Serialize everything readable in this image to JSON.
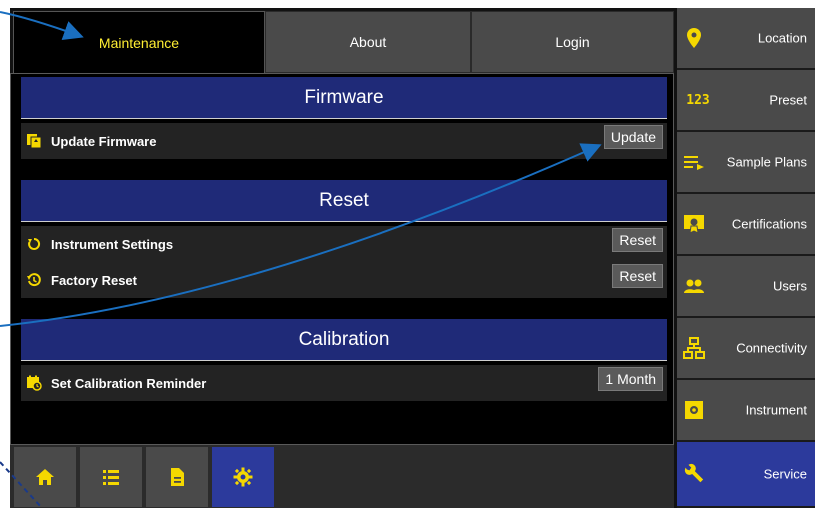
{
  "tabs": [
    {
      "label": "Maintenance",
      "active": true
    },
    {
      "label": "About",
      "active": false
    },
    {
      "label": "Login",
      "active": false
    }
  ],
  "sections": {
    "firmware": {
      "title": "Firmware",
      "rows": [
        {
          "label": "Update Firmware",
          "button": "Update",
          "icon": "firmware-update-icon"
        }
      ]
    },
    "reset": {
      "title": "Reset",
      "rows": [
        {
          "label": "Instrument Settings",
          "button": "Reset",
          "icon": "reset-icon"
        },
        {
          "label": "Factory Reset",
          "button": "Reset",
          "icon": "history-icon"
        }
      ]
    },
    "calibration": {
      "title": "Calibration",
      "rows": [
        {
          "label": "Set Calibration Reminder",
          "button": "1 Month",
          "icon": "calendar-clock-icon"
        }
      ]
    }
  },
  "bottom_nav": [
    {
      "icon": "home-icon"
    },
    {
      "icon": "list-icon"
    },
    {
      "icon": "document-icon"
    },
    {
      "icon": "gear-icon",
      "active": true
    }
  ],
  "sidebar": [
    {
      "label": "Location",
      "icon": "location-pin-icon"
    },
    {
      "label": "Preset",
      "icon": "numbers-123-icon"
    },
    {
      "label": "Sample Plans",
      "icon": "playlist-icon"
    },
    {
      "label": "Certifications",
      "icon": "certificate-icon"
    },
    {
      "label": "Users",
      "icon": "users-icon"
    },
    {
      "label": "Connectivity",
      "icon": "network-icon"
    },
    {
      "label": "Instrument",
      "icon": "instrument-icon"
    },
    {
      "label": "Service",
      "icon": "wrench-icon",
      "active": true
    }
  ],
  "colors": {
    "accent_yellow": "#ffee33",
    "header_blue": "#1f2a78",
    "active_blue": "#2c3a9c",
    "annotation_arrow": "#1a6fc0"
  }
}
